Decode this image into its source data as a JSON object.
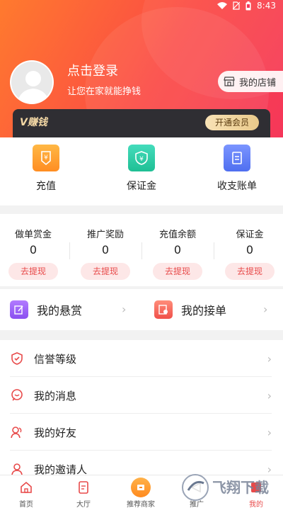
{
  "status": {
    "time": "8:43"
  },
  "profile": {
    "login_title": "点击登录",
    "login_subtitle": "让您在家就能挣钱",
    "shop_label": "我的店铺"
  },
  "vip": {
    "label": "V赚钱",
    "button": "开通会员"
  },
  "quick": [
    {
      "label": "充值",
      "icon": "recharge-icon",
      "color": "#ff9f2e"
    },
    {
      "label": "保证金",
      "icon": "deposit-icon",
      "color": "#2ccfa7"
    },
    {
      "label": "收支账单",
      "icon": "bill-icon",
      "color": "#5b7cf5"
    }
  ],
  "stats": [
    {
      "label": "做单赏金",
      "value": "0",
      "action": "去提现"
    },
    {
      "label": "推广奖励",
      "value": "0",
      "action": "去提现"
    },
    {
      "label": "充值余额",
      "value": "0",
      "action": "去提现"
    },
    {
      "label": "保证金",
      "value": "0",
      "action": "去提现"
    }
  ],
  "rewards": {
    "my_bounty": "我的悬赏",
    "my_orders": "我的接单"
  },
  "menu": [
    {
      "label": "信誉等级",
      "icon": "shield-icon"
    },
    {
      "label": "我的消息",
      "icon": "message-icon"
    },
    {
      "label": "我的好友",
      "icon": "friends-icon"
    },
    {
      "label": "我的邀请人",
      "icon": "inviter-icon"
    }
  ],
  "tabs": [
    {
      "label": "首页",
      "icon": "home-icon"
    },
    {
      "label": "大厅",
      "icon": "hall-icon"
    },
    {
      "label": "推荐商家",
      "icon": "merchant-icon"
    },
    {
      "label": "推广",
      "icon": "promote-icon"
    },
    {
      "label": "我的",
      "icon": "me-icon"
    }
  ],
  "colors": {
    "primary": "#f5365a",
    "accent": "#ff7a2e",
    "withdraw_text": "#e84a4a"
  },
  "watermark": "飞翔下载"
}
